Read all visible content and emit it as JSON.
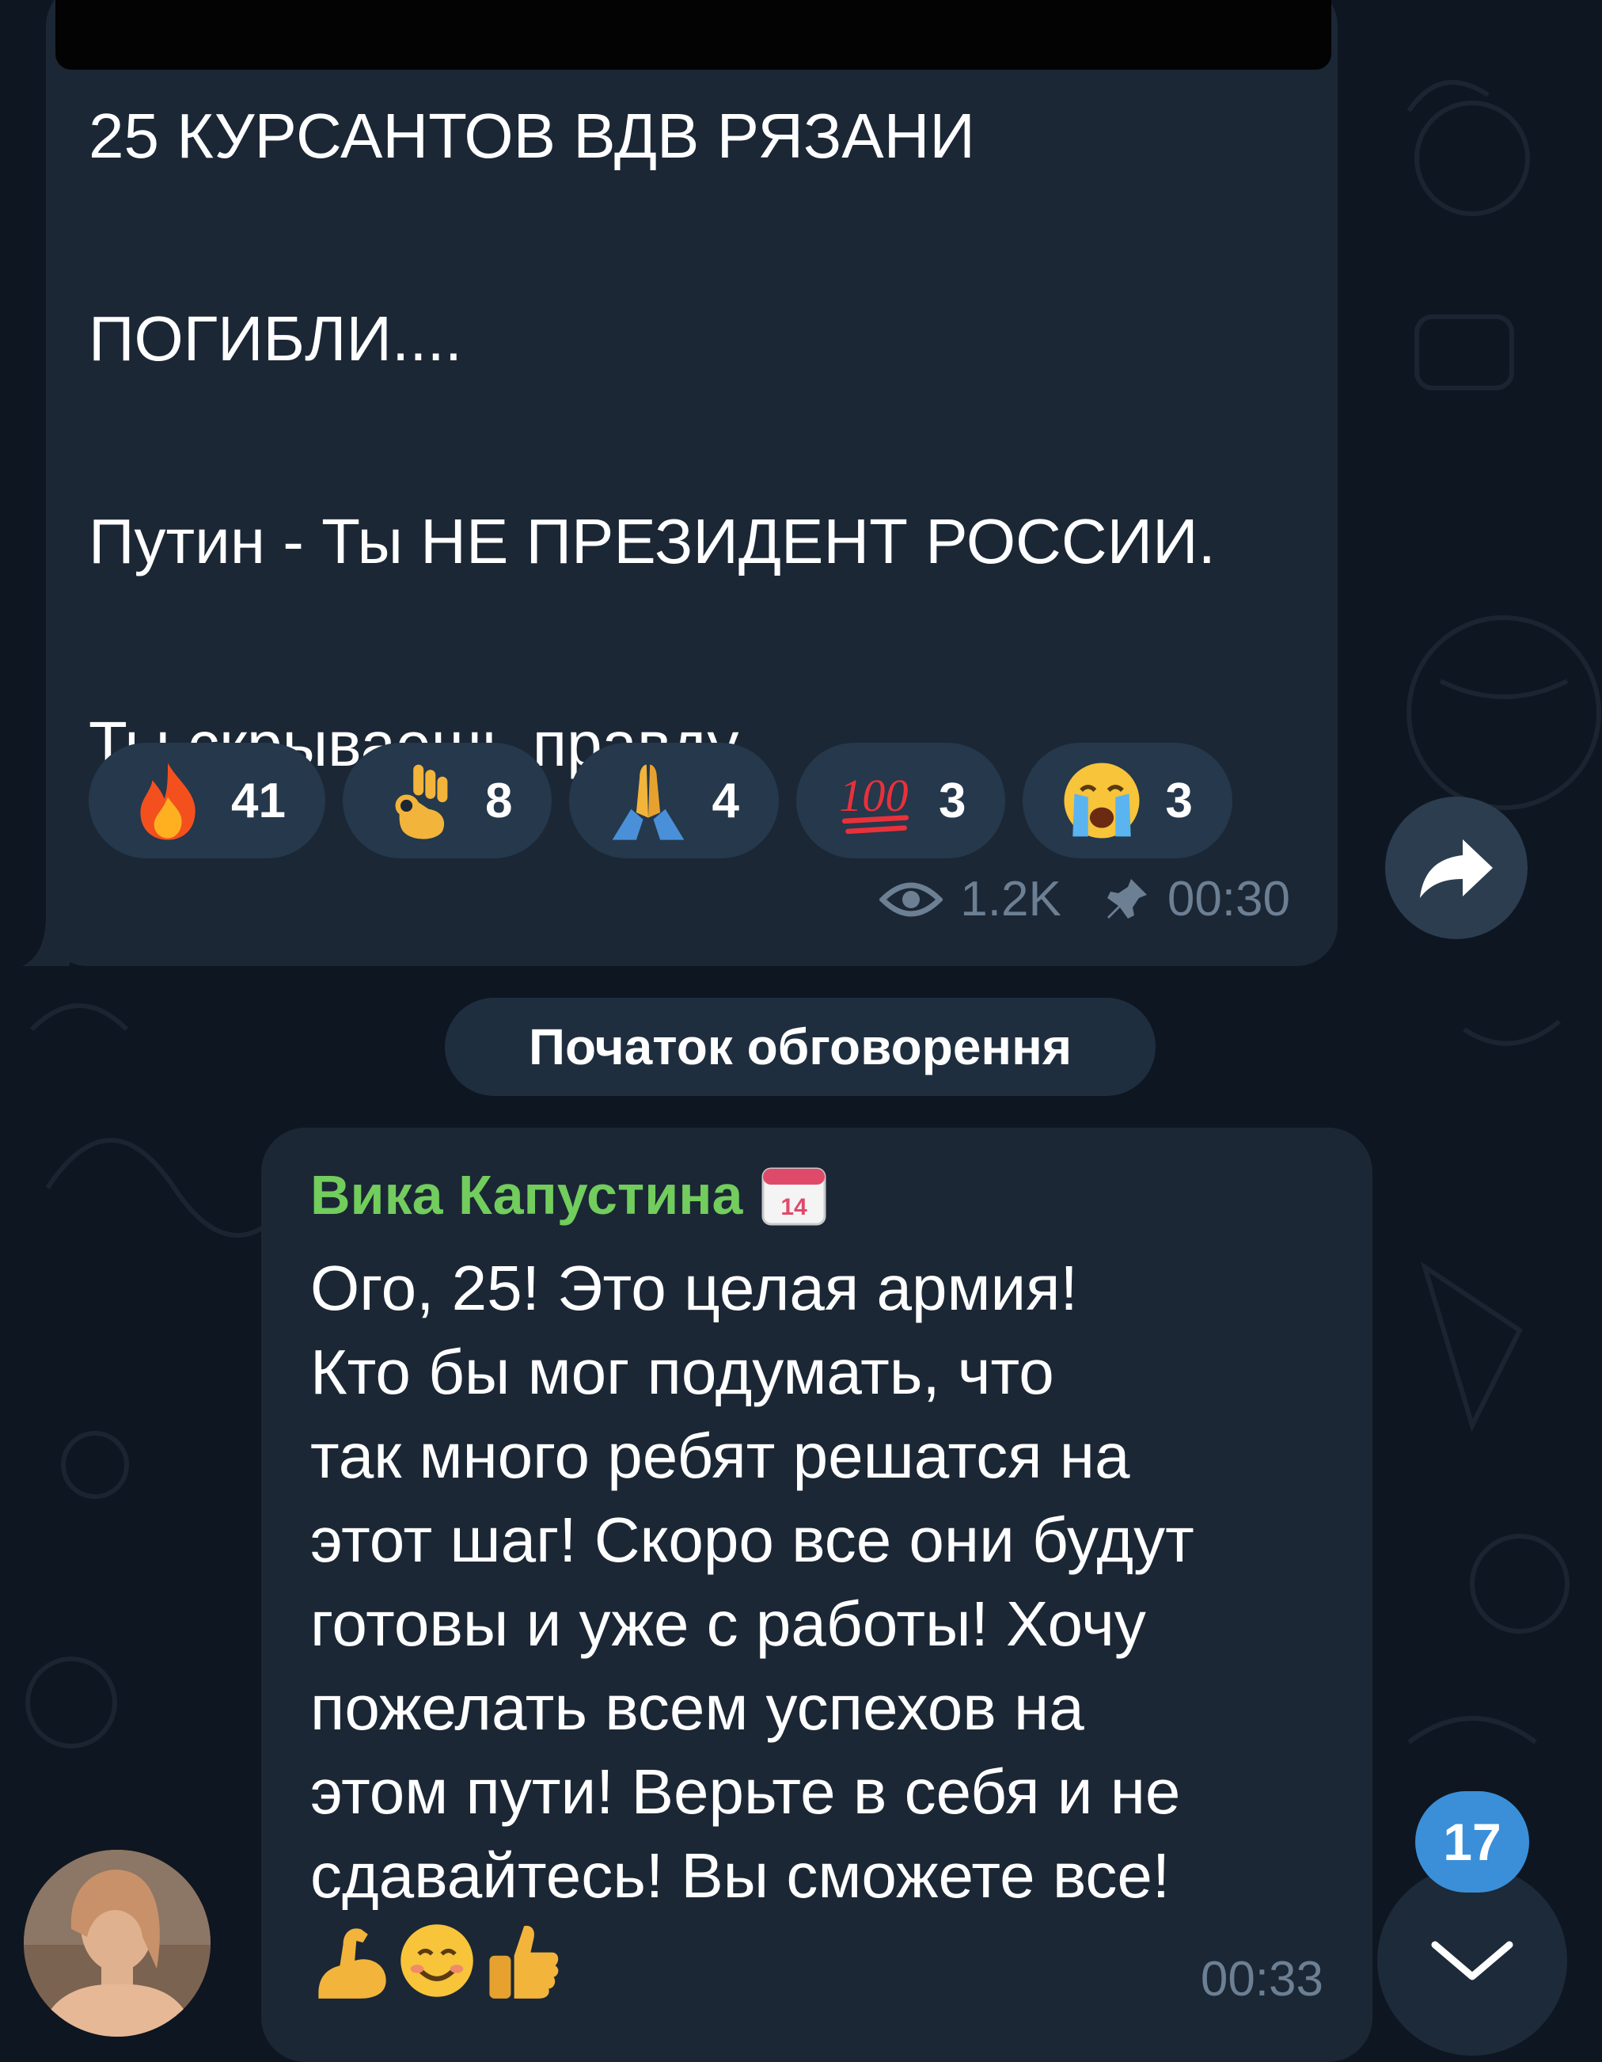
{
  "post": {
    "lines": [
      "25 КУРСАНТОВ ВДВ РЯЗАНИ",
      "ПОГИБЛИ....",
      "Путин - Ты НЕ ПРЕЗИДЕНТ РОССИИ.",
      "Ты скрываешь правду"
    ],
    "reactions": [
      {
        "icon": "fire-emoji",
        "count": "41"
      },
      {
        "icon": "ok-hand-emoji",
        "count": "8"
      },
      {
        "icon": "folded-hands-emoji",
        "count": "4"
      },
      {
        "icon": "hundred-points-emoji",
        "count": "3"
      },
      {
        "icon": "crying-face-emoji",
        "count": "3"
      }
    ],
    "views": "1.2K",
    "time": "00:30"
  },
  "service_message": "Початок обговорення",
  "comment": {
    "sender": "Вика Капустина",
    "text": "Ого, 25! Это целая армия!\nКто бы мог подумать, что\nтак много ребят решатся на\nэтот шаг! Скоро все они будут\nготовы и уже с работы! Хочу\nпожелать всем успехов на\nэтом пути! Верьте в себя и не\nсдавайтесь! Вы сможете все!",
    "emojis": [
      "flexed-biceps-emoji",
      "smiling-face-emoji",
      "thumbs-up-emoji"
    ],
    "time": "00:33"
  },
  "unread_count": "17",
  "colors": {
    "background": "#0e1621",
    "bubble": "#1b2735",
    "reaction": "#25384c",
    "sender_name": "#72cd5d",
    "meta": "#6d7f93",
    "badge": "#3a8fd8"
  }
}
